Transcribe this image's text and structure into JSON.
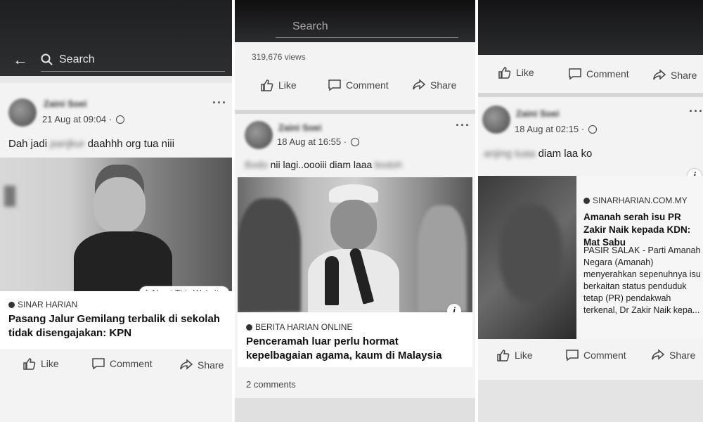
{
  "panel1": {
    "search_placeholder": "Search",
    "post": {
      "date": "21 Aug at 09:04 ·",
      "text_before": "Dah jadi",
      "text_blurred": "panjkur",
      "text_after": "daahhh org tua niii"
    },
    "link": {
      "about_label": "About This Website",
      "source": "SINAR HARIAN",
      "headline": "Pasang Jalur Gemilang terbalik di sekolah tidak disengajakan: KPN"
    },
    "actions": {
      "like": "Like",
      "comment": "Comment",
      "share": "Share"
    }
  },
  "panel2": {
    "search_placeholder": "Search",
    "views": "319,676 views",
    "actions_top": {
      "like": "Like",
      "comment": "Comment",
      "share": "Share"
    },
    "post": {
      "date": "18 Aug at 16:55 ·",
      "text_blurred_1": "Bodo",
      "text_middle": "nii lagi..oooiii diam laaa",
      "text_blurred_2": "bodoh"
    },
    "link": {
      "source": "BERITA HARIAN ONLINE",
      "headline": "Penceramah luar perlu hormat kepelbagaian agama, kaum di Malaysia"
    },
    "comments_count": "2 comments"
  },
  "panel3": {
    "actions_top": {
      "like": "Like",
      "comment": "Comment",
      "share": "Share"
    },
    "post": {
      "date": "18 Aug at 02:15 ·",
      "text_blurred": "anjing tuaa",
      "text_after": "diam laa ko"
    },
    "link": {
      "source": "SINARHARIAN.COM.MY",
      "headline": "Amanah serah isu PR Zakir Naik kepada KDN: Mat Sabu",
      "snippet": "PASIR SALAK - Parti Amanah Negara (Amanah) menyerahkan sepenuhnya isu berkaitan status penduduk tetap (PR) pendakwah terkenal, Dr Zakir Naik kepa..."
    },
    "actions": {
      "like": "Like",
      "comment": "Comment",
      "share": "Share"
    }
  },
  "icons": {
    "back": "back-arrow-icon",
    "search": "search-icon",
    "like": "thumbs-up-icon",
    "comment": "comment-bubble-icon",
    "share": "share-arrow-icon",
    "info": "info-icon",
    "globe": "globe-icon"
  }
}
